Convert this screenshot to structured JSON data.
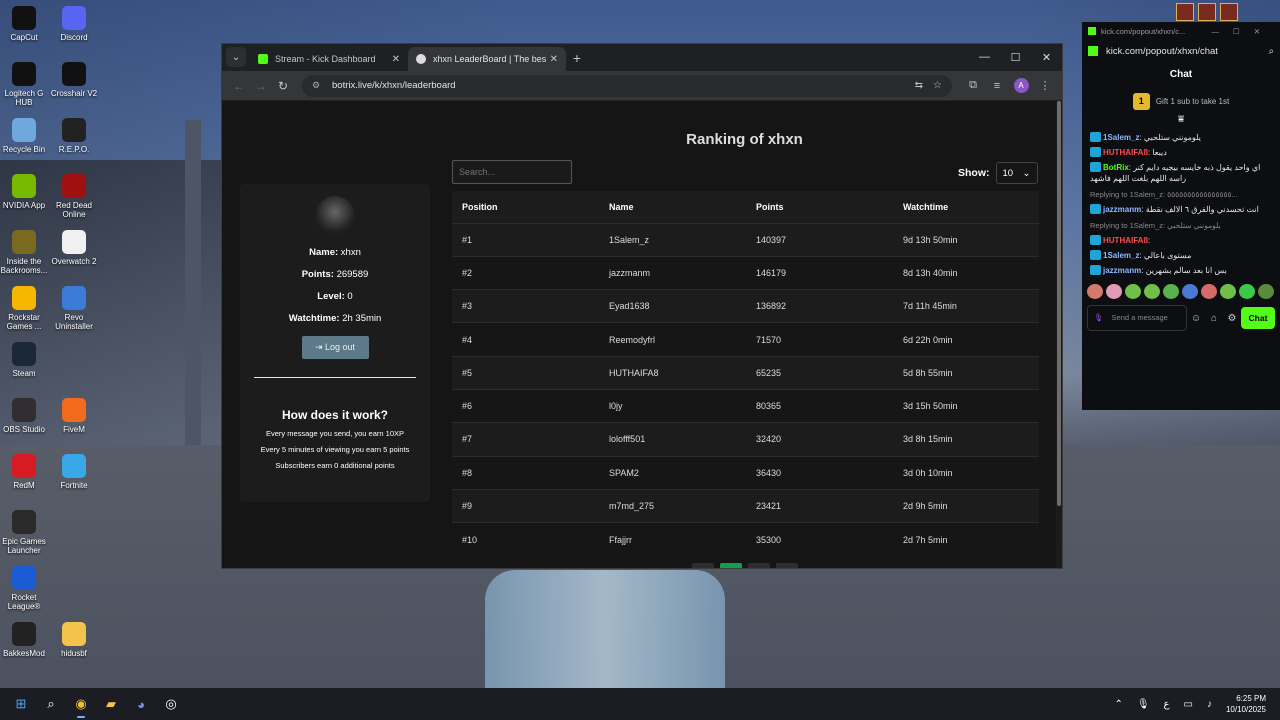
{
  "desktop": {
    "icons": [
      {
        "label": "CapCut",
        "icon": "capcut-icon",
        "color": "#111111"
      },
      {
        "label": "Discord",
        "icon": "discord-icon",
        "color": "#5865f2"
      },
      {
        "label": "Logitech G HUB",
        "icon": "logitech-icon",
        "color": "#111111"
      },
      {
        "label": "Crosshair V2",
        "icon": "crosshair-icon",
        "color": "#111111"
      },
      {
        "label": "Recycle Bin",
        "icon": "recycle-bin-icon",
        "color": "#6fa8dc"
      },
      {
        "label": "R.E.P.O.",
        "icon": "repo-icon",
        "color": "#222222"
      },
      {
        "label": "NVIDIA App",
        "icon": "nvidia-icon",
        "color": "#76b900"
      },
      {
        "label": "Red Dead Online",
        "icon": "red-dead-icon",
        "color": "#a01010"
      },
      {
        "label": "Inside the Backrooms...",
        "icon": "backrooms-icon",
        "color": "#7a6a20"
      },
      {
        "label": "Overwatch 2",
        "icon": "overwatch-icon",
        "color": "#f0f0f0"
      },
      {
        "label": "Rockstar Games ...",
        "icon": "rockstar-icon",
        "color": "#f5b700"
      },
      {
        "label": "Revo Uninstaller",
        "icon": "revo-icon",
        "color": "#3d7bd9"
      },
      {
        "label": "Steam",
        "icon": "steam-icon",
        "color": "#1b2838"
      },
      {
        "label": "OBS Studio",
        "icon": "obs-icon",
        "color": "#302e31"
      },
      {
        "label": "FiveM",
        "icon": "fivem-icon",
        "color": "#f26b1d"
      },
      {
        "label": "RedM",
        "icon": "redm-icon",
        "color": "#d61c22"
      },
      {
        "label": "Fortnite",
        "icon": "fortnite-icon",
        "color": "#3aa7e8"
      },
      {
        "label": "Epic Games Launcher",
        "icon": "epic-icon",
        "color": "#2a2a2a"
      },
      {
        "label": "Rocket League®",
        "icon": "rocket-league-icon",
        "color": "#1c5bd6"
      },
      {
        "label": "BakkesMod",
        "icon": "bakkesmod-icon",
        "color": "#222222"
      },
      {
        "label": "hidusbf",
        "icon": "folder-icon",
        "color": "#f3c34c"
      }
    ]
  },
  "browser": {
    "tabs": [
      {
        "label": "Stream - Kick Dashboard",
        "favicon_color": "#53fc18"
      },
      {
        "label": "xhxn LeaderBoard | The best Ch",
        "favicon_color": "#dddddd"
      }
    ],
    "url": "botrix.live/k/xhxn/leaderboard",
    "avatar_letter": "A"
  },
  "page": {
    "title": "Ranking of xhxn",
    "profile": {
      "name_label": "Name:",
      "name": "xhxn",
      "points_label": "Points:",
      "points": "269589",
      "level_label": "Level:",
      "level": "0",
      "watchtime_label": "Watchtime:",
      "watchtime": "2h 35min",
      "logout": "Log out"
    },
    "how": {
      "title": "How does it work?",
      "lines": [
        "Every message you send, you earn 10XP",
        "Every 5 minutes of viewing you earn 5 points",
        "Subscribers earn 0 additional points"
      ]
    },
    "search_placeholder": "Search...",
    "show_label": "Show:",
    "show_value": "10",
    "columns": [
      "Position",
      "Name",
      "Points",
      "Watchtime"
    ],
    "rows": [
      [
        "#1",
        "1Salem_z",
        "140397",
        "9d 13h 50min"
      ],
      [
        "#2",
        "jazzmanm",
        "146179",
        "8d 13h 40min"
      ],
      [
        "#3",
        "Eyad1638",
        "136892",
        "7d 11h 45min"
      ],
      [
        "#4",
        "Reemodyfrl",
        "71570",
        "6d 22h 0min"
      ],
      [
        "#5",
        "HUTHAIFA8",
        "65235",
        "5d 8h 55min"
      ],
      [
        "#6",
        "l0jy",
        "80365",
        "3d 15h 50min"
      ],
      [
        "#7",
        "lolofff501",
        "32420",
        "3d 8h 15min"
      ],
      [
        "#8",
        "SPAM2",
        "36430",
        "3d 0h 10min"
      ],
      [
        "#9",
        "m7md_275",
        "23421",
        "2d 9h 5min"
      ],
      [
        "#10",
        "Ffajjrr",
        "35300",
        "2d 7h 5min"
      ]
    ]
  },
  "chat": {
    "window_title": "kick.com/popout/xhxn/c...",
    "url": "kick.com/popout/xhxn/chat",
    "header": "Chat",
    "gift_count": "1",
    "gift_text": "Gift 1 sub to take 1st",
    "messages": [
      {
        "reply": "",
        "user": "1Salem_z",
        "color": "#8fb7ff",
        "text": "يلومونني ستلحبي"
      },
      {
        "reply": "",
        "user": "HUTHAIFA8",
        "color": "#ff4d4d",
        "text": "ديبعا"
      },
      {
        "reply": "",
        "user": "BotRix",
        "color": "#53fc18",
        "text": "اي واحد يقول ذبه خايسه بيجيه دايم كنر راسه اللهم بلغت اللهم فاشهد"
      },
      {
        "reply": "Replying to 1Salem_z: ٥٥٥٥٥٥٥٥٥٥٥٥٥٥٥٥...",
        "user": "jazzmanm",
        "color": "#8fb7ff",
        "text": "انت تحسدني والفرق ٦ الالف نقطة"
      },
      {
        "reply": "Replying to 1Salem_z: يلومونني ستلحبي",
        "user": "HUTHAIFA8",
        "color": "#ff4d4d",
        "text": ""
      },
      {
        "reply": "",
        "user": "1Salem_z",
        "color": "#8fb7ff",
        "text": "مستوى باعالي"
      },
      {
        "reply": "",
        "user": "jazzmanm",
        "color": "#8fb7ff",
        "text": "بس انا بعد سالم بشهرين"
      }
    ],
    "input_placeholder": "Send a message",
    "chat_button": "Chat"
  },
  "taskbar": {
    "time": "6:25 PM",
    "date": "10/10/2025",
    "lang": "ع"
  }
}
